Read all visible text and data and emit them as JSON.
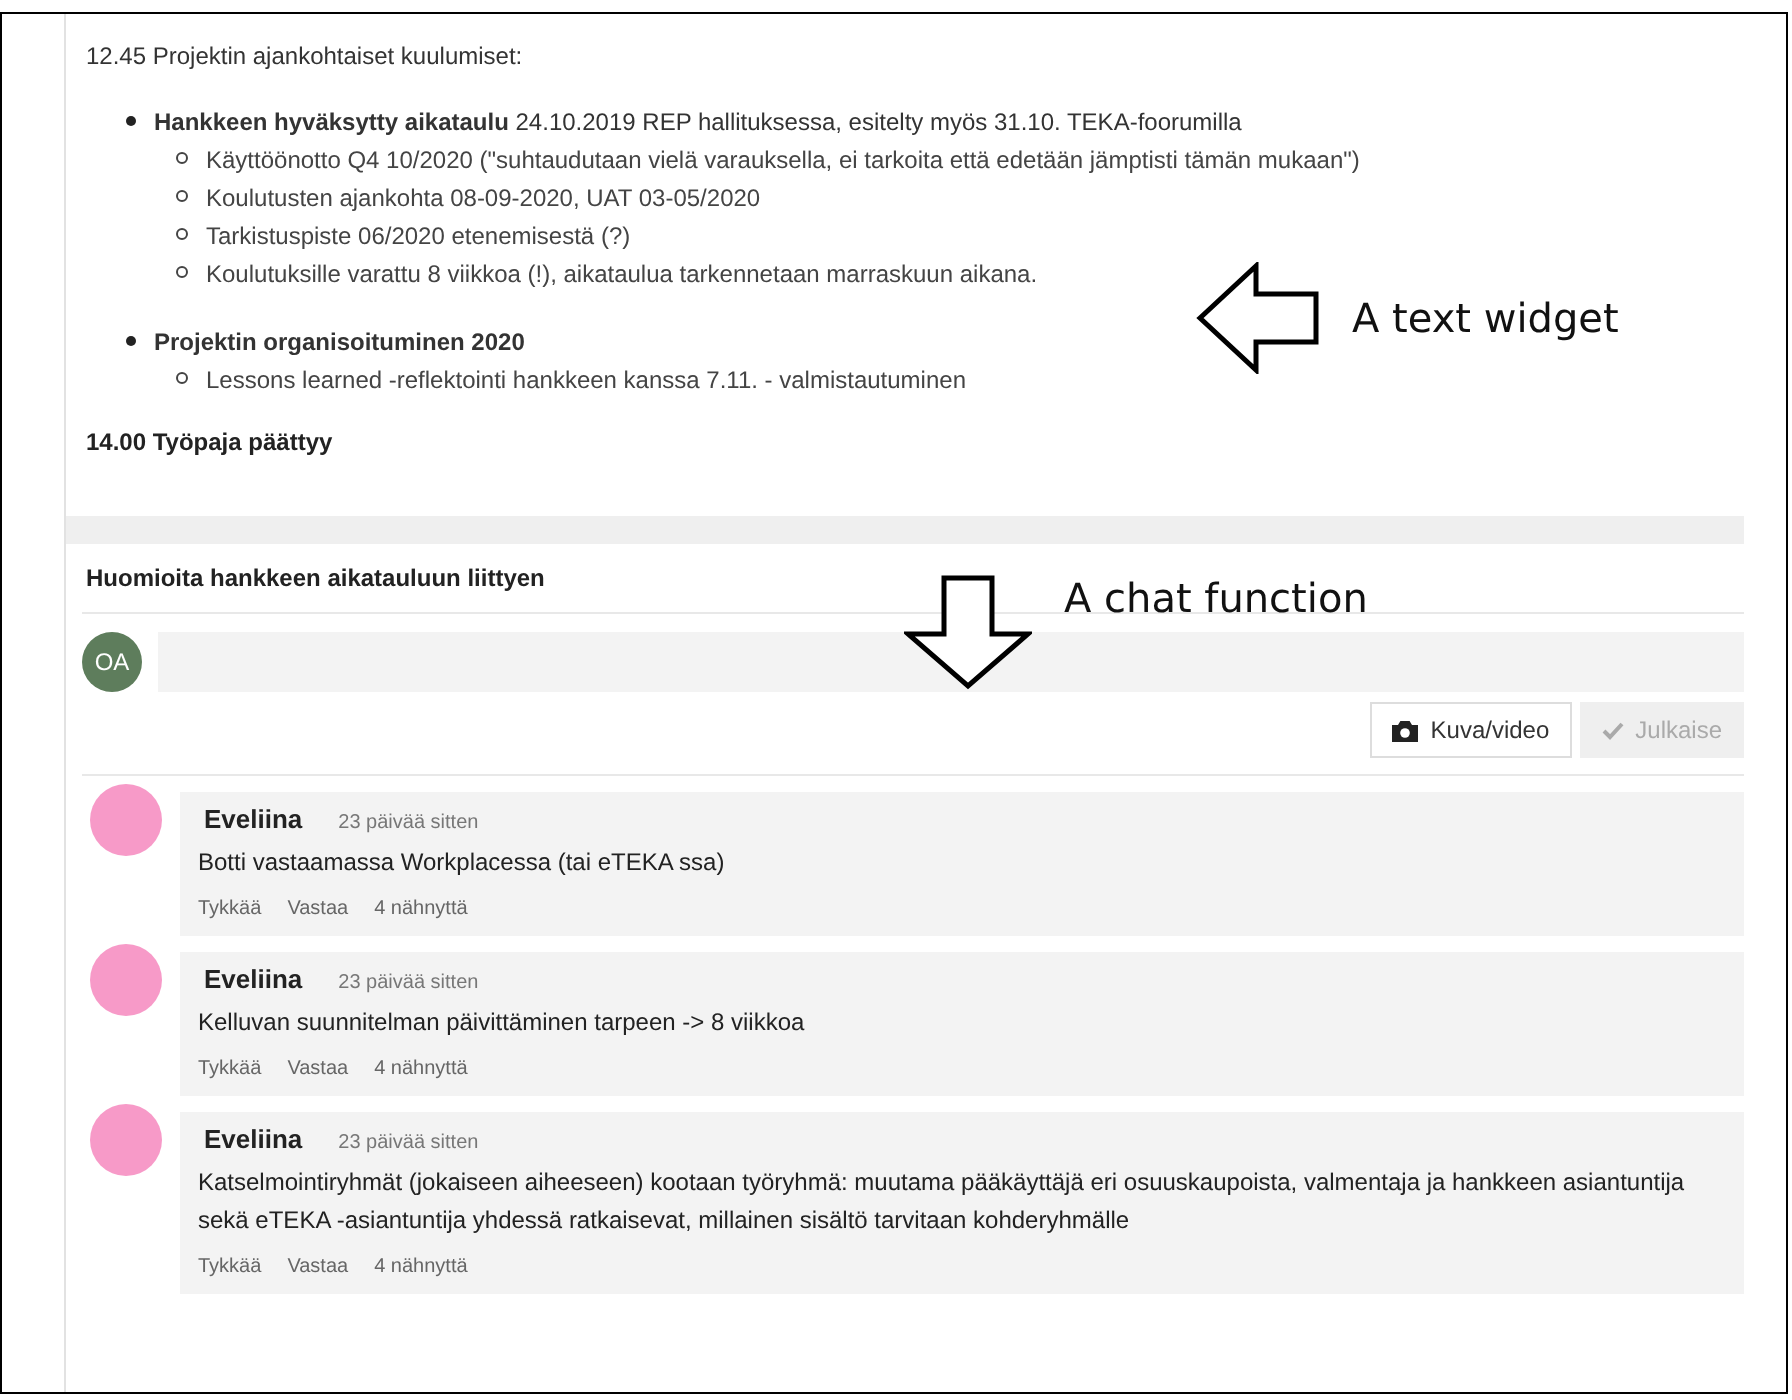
{
  "text_widget": {
    "heading": "12.45 Projektin ajankohtaiset kuulumiset:",
    "items": [
      {
        "text": "**Hankkeen hyväksytty aikataulu** 24.10.2019  REP hallituksessa, esitelty myös 31.10.  TEKA-foorumilla",
        "children": [
          {
            "text": "Käyttöönotto Q4 10/2020 (\"suhtaudutaan vielä varauksella, ei tarkoita että edetään jämptisti tämän mukaan\")"
          },
          {
            "text": "Koulutusten ajankohta 08-09-2020, UAT 03-05/2020"
          },
          {
            "text": "Tarkistuspiste 06/2020 etenemisestä (?)"
          },
          {
            "text": "Koulutuksille varattu 8 viikkoa (!), aikataulua tarkennetaan marraskuun aikana."
          }
        ]
      },
      {
        "text": "**Projektin organisoituminen 2020**",
        "children": [
          {
            "text": "Lessons learned -reflektointi hankkeen kanssa 7.11. - valmistautuminen"
          }
        ]
      }
    ],
    "footer": "14.00 Työpaja päättyy"
  },
  "annotations": [
    {
      "kind": "left",
      "label": "A text widget"
    },
    {
      "kind": "down",
      "label": "A chat function"
    }
  ],
  "chat": {
    "title": "Huomioita hankkeen aikatauluun liittyen",
    "composer": {
      "avatar": "OA",
      "buttons": [
        {
          "kind": "camera",
          "label": "Kuva/video",
          "disabled": false
        },
        {
          "kind": "check",
          "label": "Julkaise",
          "disabled": true
        }
      ]
    },
    "comments": [
      {
        "author": "Eveliina",
        "time": "23 päivää sitten",
        "text": "Botti vastaamassa Workplacessa (tai  eTEKA ssa)",
        "actions": [
          "Tykkää",
          "Vastaa",
          "4 nähnyttä"
        ]
      },
      {
        "author": "Eveliina",
        "time": "23 päivää sitten",
        "text": "Kelluvan suunnitelman päivittäminen tarpeen -> 8 viikkoa",
        "actions": [
          "Tykkää",
          "Vastaa",
          "4 nähnyttä"
        ]
      },
      {
        "author": "Eveliina",
        "time": "23 päivää sitten",
        "text": "Katselmointiryhmät (jokaiseen aiheeseen) kootaan työryhmä: muutama pääkäyttäjä eri osuuskaupoista, valmentaja ja hankkeen asiantuntija sekä  eTEKA -asiantuntija yhdessä ratkaisevat, millainen sisältö tarvitaan kohderyhmälle",
        "actions": [
          "Tykkää",
          "Vastaa",
          "4 nähnyttä"
        ]
      }
    ]
  }
}
